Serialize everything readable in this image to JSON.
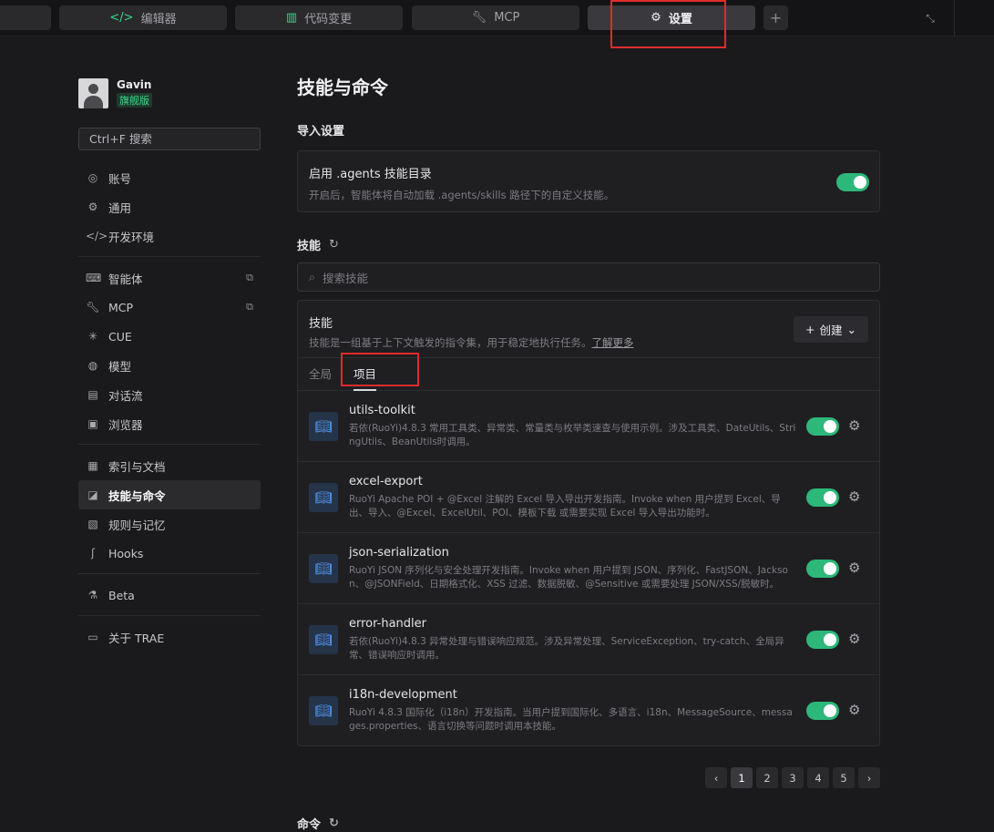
{
  "topbar": {
    "tabs": [
      {
        "label": "编辑器",
        "icon": "code-icon"
      },
      {
        "label": "代码变更",
        "icon": "diff-icon"
      },
      {
        "label": "MCP",
        "icon": "wrench-icon"
      },
      {
        "label": "设置",
        "icon": "gear-icon"
      }
    ],
    "add_label": "+"
  },
  "sidebar": {
    "user": {
      "name": "Gavin",
      "badge": "旗舰版"
    },
    "search_label": "Ctrl+F 搜索",
    "groups": [
      [
        {
          "label": "账号",
          "icon": "user-icon"
        },
        {
          "label": "通用",
          "icon": "gear-icon"
        },
        {
          "label": "开发环境",
          "icon": "code-icon"
        }
      ],
      [
        {
          "label": "智能体",
          "icon": "bot-icon"
        },
        {
          "label": "MCP",
          "icon": "wrench-icon"
        },
        {
          "label": "CUE",
          "icon": "cue-icon"
        },
        {
          "label": "模型",
          "icon": "model-icon"
        },
        {
          "label": "对话流",
          "icon": "chat-icon"
        },
        {
          "label": "浏览器",
          "icon": "browser-icon"
        }
      ],
      [
        {
          "label": "索引与文档",
          "icon": "index-icon"
        },
        {
          "label": "技能与命令",
          "icon": "skill-icon"
        },
        {
          "label": "规则与记忆",
          "icon": "rule-icon"
        },
        {
          "label": "Hooks",
          "icon": "hook-icon"
        }
      ],
      [
        {
          "label": "Beta",
          "icon": "flask-icon"
        }
      ],
      [
        {
          "label": "关于 TRAE",
          "icon": "info-icon"
        }
      ]
    ]
  },
  "main": {
    "title": "技能与命令",
    "import_section": {
      "title": "导入设置",
      "card_title": "启用 .agents 技能目录",
      "card_desc": "开启后，智能体将自动加载 .agents/skills 路径下的自定义技能。",
      "enabled": true
    },
    "skills_section": {
      "title": "技能",
      "search_placeholder": "搜索技能",
      "card_title": "技能",
      "card_desc": "技能是一组基于上下文触发的指令集，用于稳定地执行任务。",
      "card_link": "了解更多",
      "create_label": "创建",
      "tabs": [
        "全局",
        "项目"
      ],
      "active_tab": "项目",
      "items": [
        {
          "name": "utils-toolkit",
          "desc": "若依(RuoYi)4.8.3 常用工具类、异常类、常量类与枚举类速查与使用示例。涉及工具类、DateUtils、StringUtils、BeanUtils时调用。",
          "enabled": true
        },
        {
          "name": "excel-export",
          "desc": "RuoYi Apache POI + @Excel 注解的 Excel 导入导出开发指南。Invoke when 用户提到 Excel、导出、导入、@Excel、ExcelUtil、POI、模板下载 或需要实现 Excel 导入导出功能时。",
          "enabled": true
        },
        {
          "name": "json-serialization",
          "desc": "RuoYi JSON 序列化与安全处理开发指南。Invoke when 用户提到 JSON、序列化、FastJSON、Jackson、@JSONField、日期格式化、XSS 过滤、数据脱敏、@Sensitive 或需要处理 JSON/XSS/脱敏时。",
          "enabled": true
        },
        {
          "name": "error-handler",
          "desc": "若依(RuoYi)4.8.3 异常处理与错误响应规范。涉及异常处理、ServiceException、try-catch、全局异常、错误响应时调用。",
          "enabled": true
        },
        {
          "name": "i18n-development",
          "desc": "RuoYi 4.8.3 国际化（i18n）开发指南。当用户提到国际化、多语言、i18n、MessageSource、messages.properties、语言切换等问题时调用本技能。",
          "enabled": true
        }
      ]
    },
    "pagination": {
      "pages": [
        "1",
        "2",
        "3",
        "4",
        "5"
      ],
      "current": "1"
    },
    "commands_section": {
      "title": "命令"
    }
  },
  "colors": {
    "accent": "#2db87a",
    "highlight": "#e02b2b",
    "background": "#1a1a1c"
  }
}
